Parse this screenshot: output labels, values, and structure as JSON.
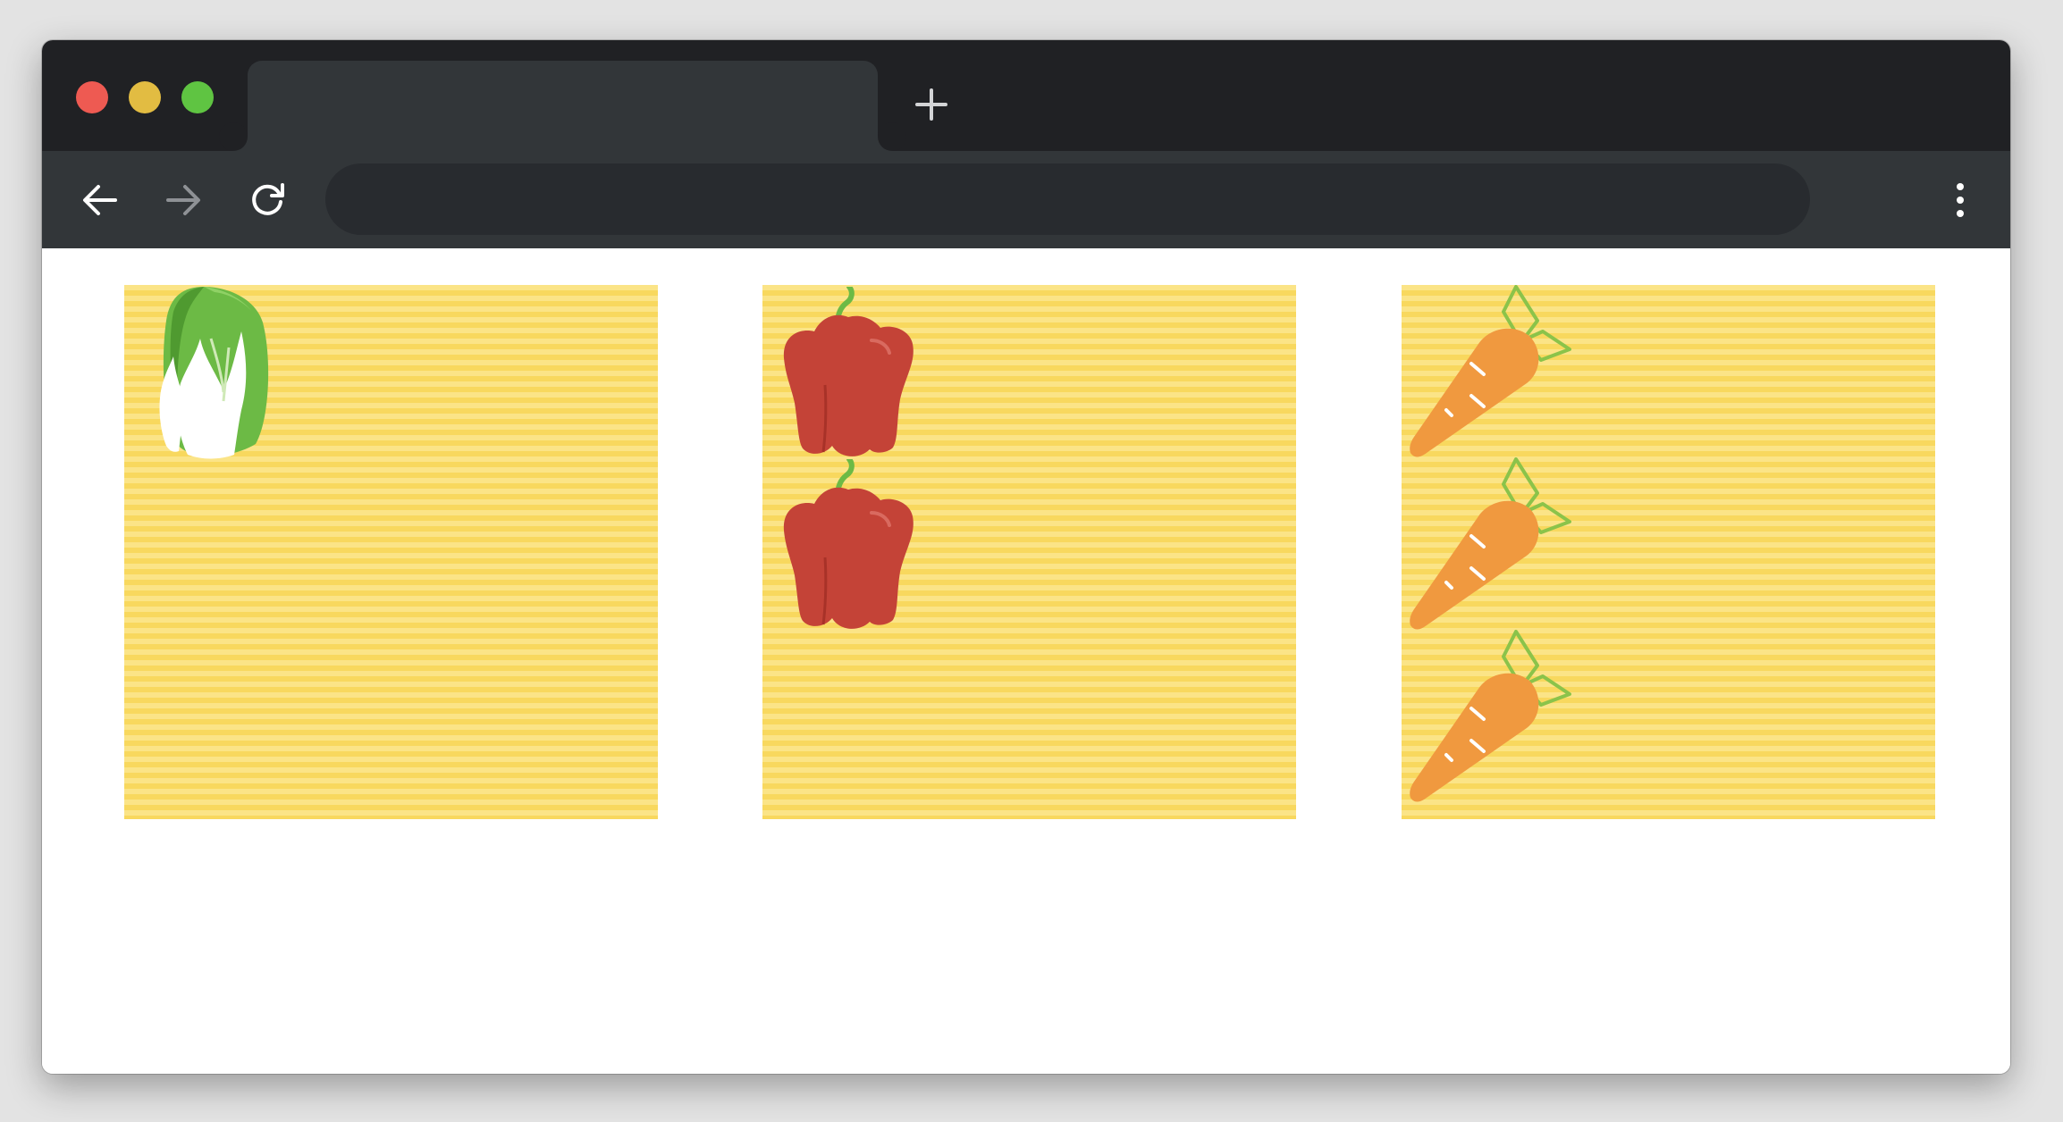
{
  "window": {
    "controls": [
      "close",
      "minimize",
      "maximize"
    ],
    "tab": {
      "title": ""
    },
    "new_tab_icon": "plus-icon"
  },
  "toolbar": {
    "back_icon": "arrow-left-icon",
    "forward_icon": "arrow-right-icon",
    "reload_icon": "reload-icon",
    "address": "",
    "menu_icon": "kebab-menu-icon"
  },
  "colors": {
    "titlebar": "#202124",
    "toolbar": "#323639",
    "omnibox": "#282b2f",
    "stripe_light": "#fbe487",
    "stripe_dark": "#f8d85e",
    "cabbage_green": "#6cba45",
    "pepper_red": "#c44337",
    "carrot_orange": "#f0993f"
  },
  "content": {
    "panels": [
      {
        "vegetable": "cabbage",
        "count": 1
      },
      {
        "vegetable": "pepper",
        "count": 2
      },
      {
        "vegetable": "carrot",
        "count": 3
      }
    ]
  }
}
